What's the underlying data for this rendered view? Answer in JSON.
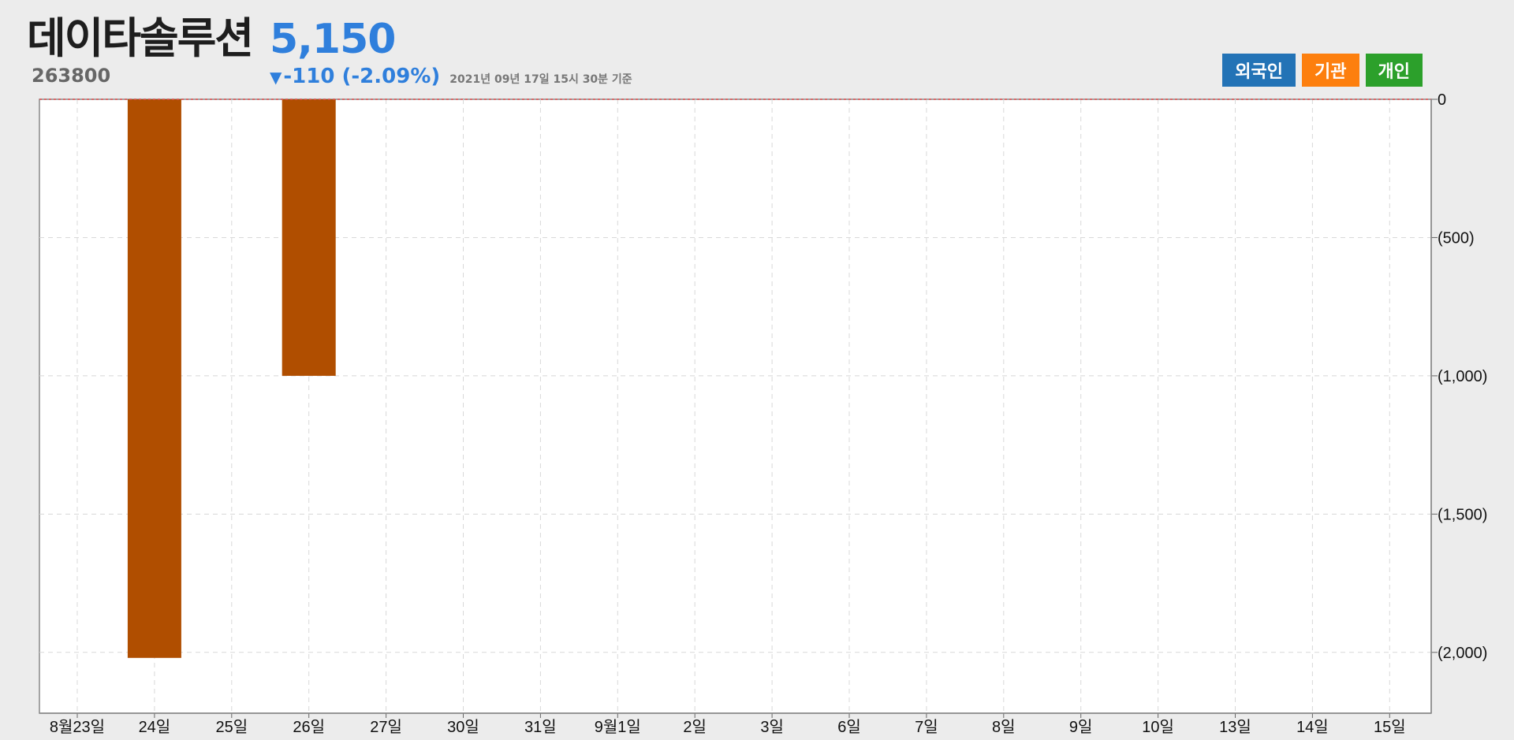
{
  "header": {
    "stock_name": "데이타솔루션",
    "stock_code": "263800",
    "price": "5,150",
    "change_arrow": "▼",
    "change": "-110 (-2.09%)",
    "timestamp": "2021년 09년 17일 15시 30분 기준"
  },
  "legend": [
    {
      "label": "외국인",
      "color": "#2373b6"
    },
    {
      "label": "기관",
      "color": "#fd7f0e"
    },
    {
      "label": "개인",
      "color": "#2ca02b"
    }
  ],
  "chart_data": {
    "type": "bar",
    "categories": [
      "8월23일",
      "24일",
      "25일",
      "26일",
      "27일",
      "30일",
      "31일",
      "9월1일",
      "2일",
      "3일",
      "6일",
      "7일",
      "8일",
      "9일",
      "10일",
      "13일",
      "14일",
      "15일"
    ],
    "series": [
      {
        "name": "기관",
        "color": "#b04e00",
        "values": [
          0,
          -2020,
          0,
          -1000,
          0,
          0,
          0,
          0,
          0,
          0,
          0,
          0,
          0,
          0,
          0,
          0,
          0,
          0
        ]
      }
    ],
    "y_ticks": [
      0,
      -500,
      -1000,
      -1500,
      -2000
    ],
    "y_tick_labels": [
      "0",
      "(500)",
      "(1,000)",
      "(1,500)",
      "(2,000)"
    ],
    "ylim": [
      -2220,
      0
    ],
    "grid": true,
    "y_axis_side": "right",
    "zero_line_color": "#e05050"
  }
}
